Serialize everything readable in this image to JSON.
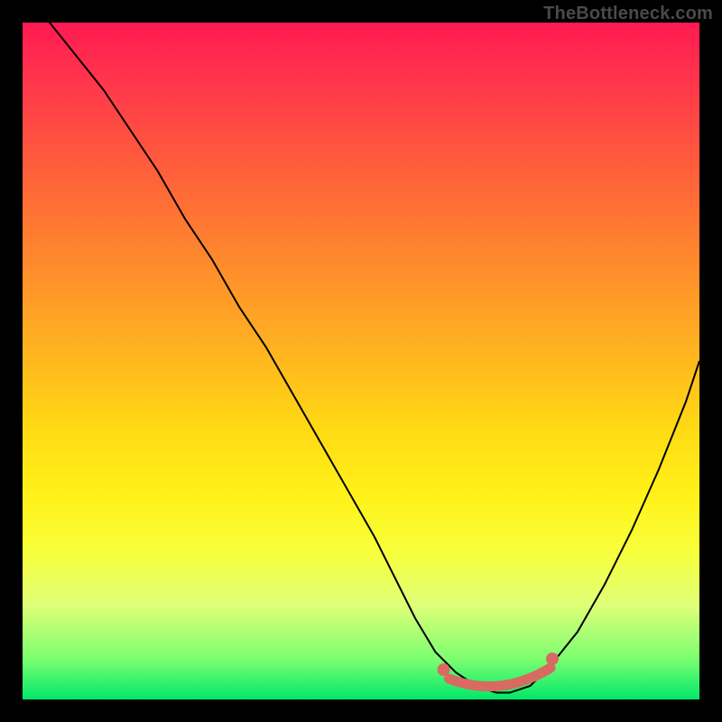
{
  "watermark": "TheBottleneck.com",
  "colors": {
    "frame": "#000000",
    "gradient_top": "#ff1a52",
    "gradient_bottom": "#00e86a",
    "curve": "#000000",
    "marker": "#d86a62"
  },
  "chart_data": {
    "type": "line",
    "title": "",
    "xlabel": "",
    "ylabel": "",
    "xlim": [
      0,
      100
    ],
    "ylim": [
      0,
      100
    ],
    "grid": false,
    "legend": false,
    "series": [
      {
        "name": "bottleneck_curve",
        "x": [
          0,
          4,
          8,
          12,
          16,
          20,
          24,
          28,
          32,
          36,
          40,
          44,
          48,
          52,
          55,
          58,
          61,
          64,
          67,
          70,
          72,
          75,
          78,
          82,
          86,
          90,
          94,
          98,
          100
        ],
        "y": [
          105,
          100,
          95,
          90,
          84,
          78,
          71,
          65,
          58,
          52,
          45,
          38,
          31,
          24,
          18,
          12,
          7,
          4,
          2,
          1,
          1,
          2,
          5,
          10,
          17,
          25,
          34,
          44,
          50
        ]
      }
    ],
    "annotations": {
      "flat_region_markers": {
        "x_range": [
          63,
          78
        ],
        "y": 2
      }
    }
  }
}
